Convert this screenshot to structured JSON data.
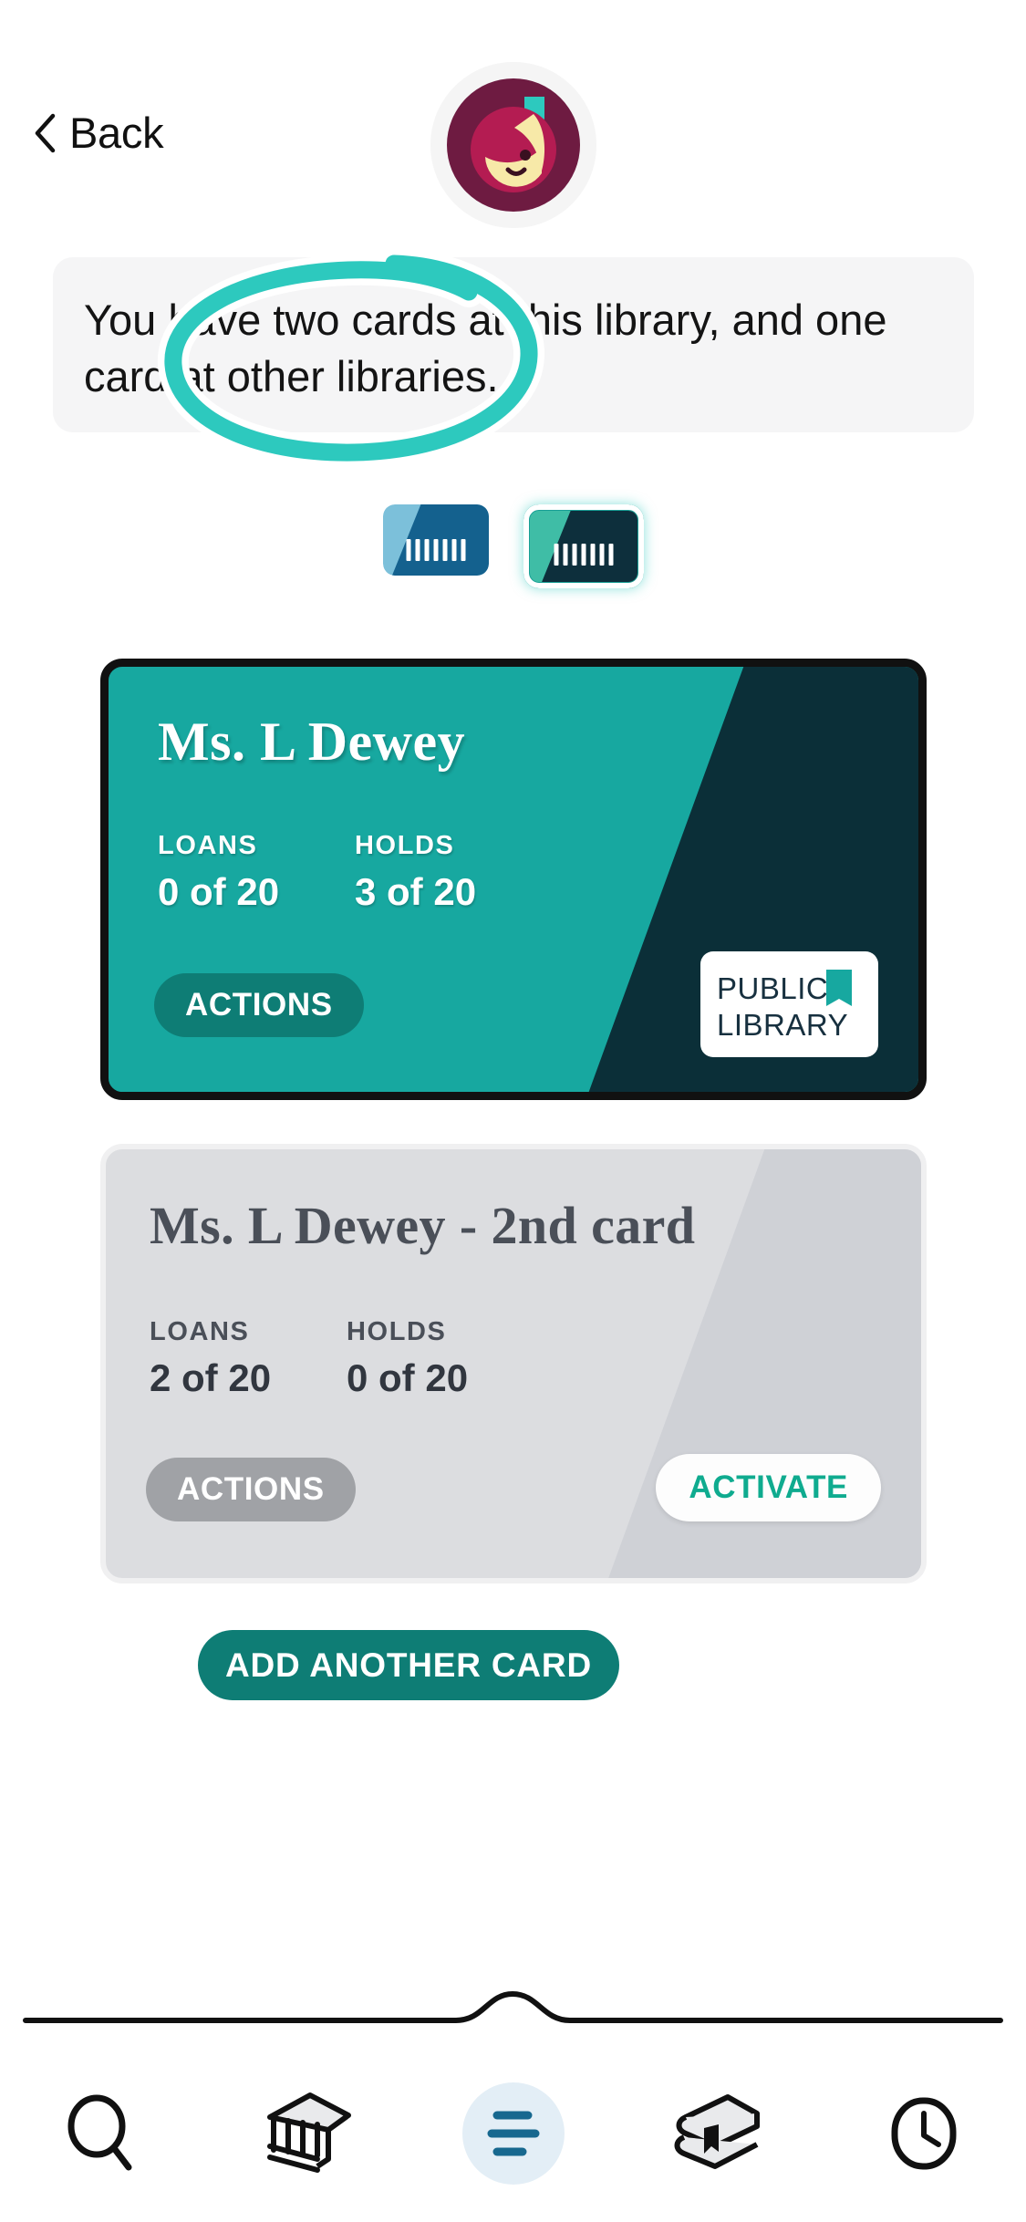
{
  "header": {
    "back_label": "Back",
    "back_icon": "chevron-left-icon",
    "avatar_icon": "user-avatar-icon"
  },
  "banner": {
    "text": "You have two cards at this library, and one card at other libraries."
  },
  "card_selector": {
    "chips": [
      {
        "name": "library-card-chip-1",
        "state": "inactive",
        "icon": "card-icon"
      },
      {
        "name": "library-card-chip-2",
        "state": "selected",
        "icon": "card-icon"
      }
    ]
  },
  "annotation": {
    "type": "hand-drawn-ellipse",
    "color": "#2dc9be",
    "target": "card-selector-chips"
  },
  "cards": [
    {
      "name": "Ms. L Dewey",
      "state": "active",
      "loans_label": "LOANS",
      "loans_value": "0 of 20",
      "holds_label": "HOLDS",
      "holds_value": "3 of 20",
      "actions_label": "ACTIONS",
      "logo_line1": "PUBLIC",
      "logo_line2": "LIBRARY",
      "bg_color": "#17a8a0",
      "accent_color": "#0b2f38"
    },
    {
      "name": "Ms. L Dewey - 2nd card",
      "state": "inactive",
      "loans_label": "LOANS",
      "loans_value": "2 of 20",
      "holds_label": "HOLDS",
      "holds_value": "0 of 20",
      "actions_label": "ACTIONS",
      "activate_label": "ACTIVATE",
      "bg_color": "#dcdde0",
      "accent_color": "#0fab8f"
    }
  ],
  "add_card": {
    "label": "ADD ANOTHER CARD",
    "color": "#0e7d75"
  },
  "bottom_nav": {
    "items": [
      {
        "name": "nav-search",
        "icon": "search-icon",
        "active": false
      },
      {
        "name": "nav-library",
        "icon": "building-icon",
        "active": false
      },
      {
        "name": "nav-menu",
        "icon": "menu-icon",
        "active": true
      },
      {
        "name": "nav-shelf",
        "icon": "books-icon",
        "active": false
      },
      {
        "name": "nav-history",
        "icon": "clock-icon",
        "active": false
      }
    ],
    "active_color": "#17688f",
    "active_bg": "#e3eef6"
  }
}
